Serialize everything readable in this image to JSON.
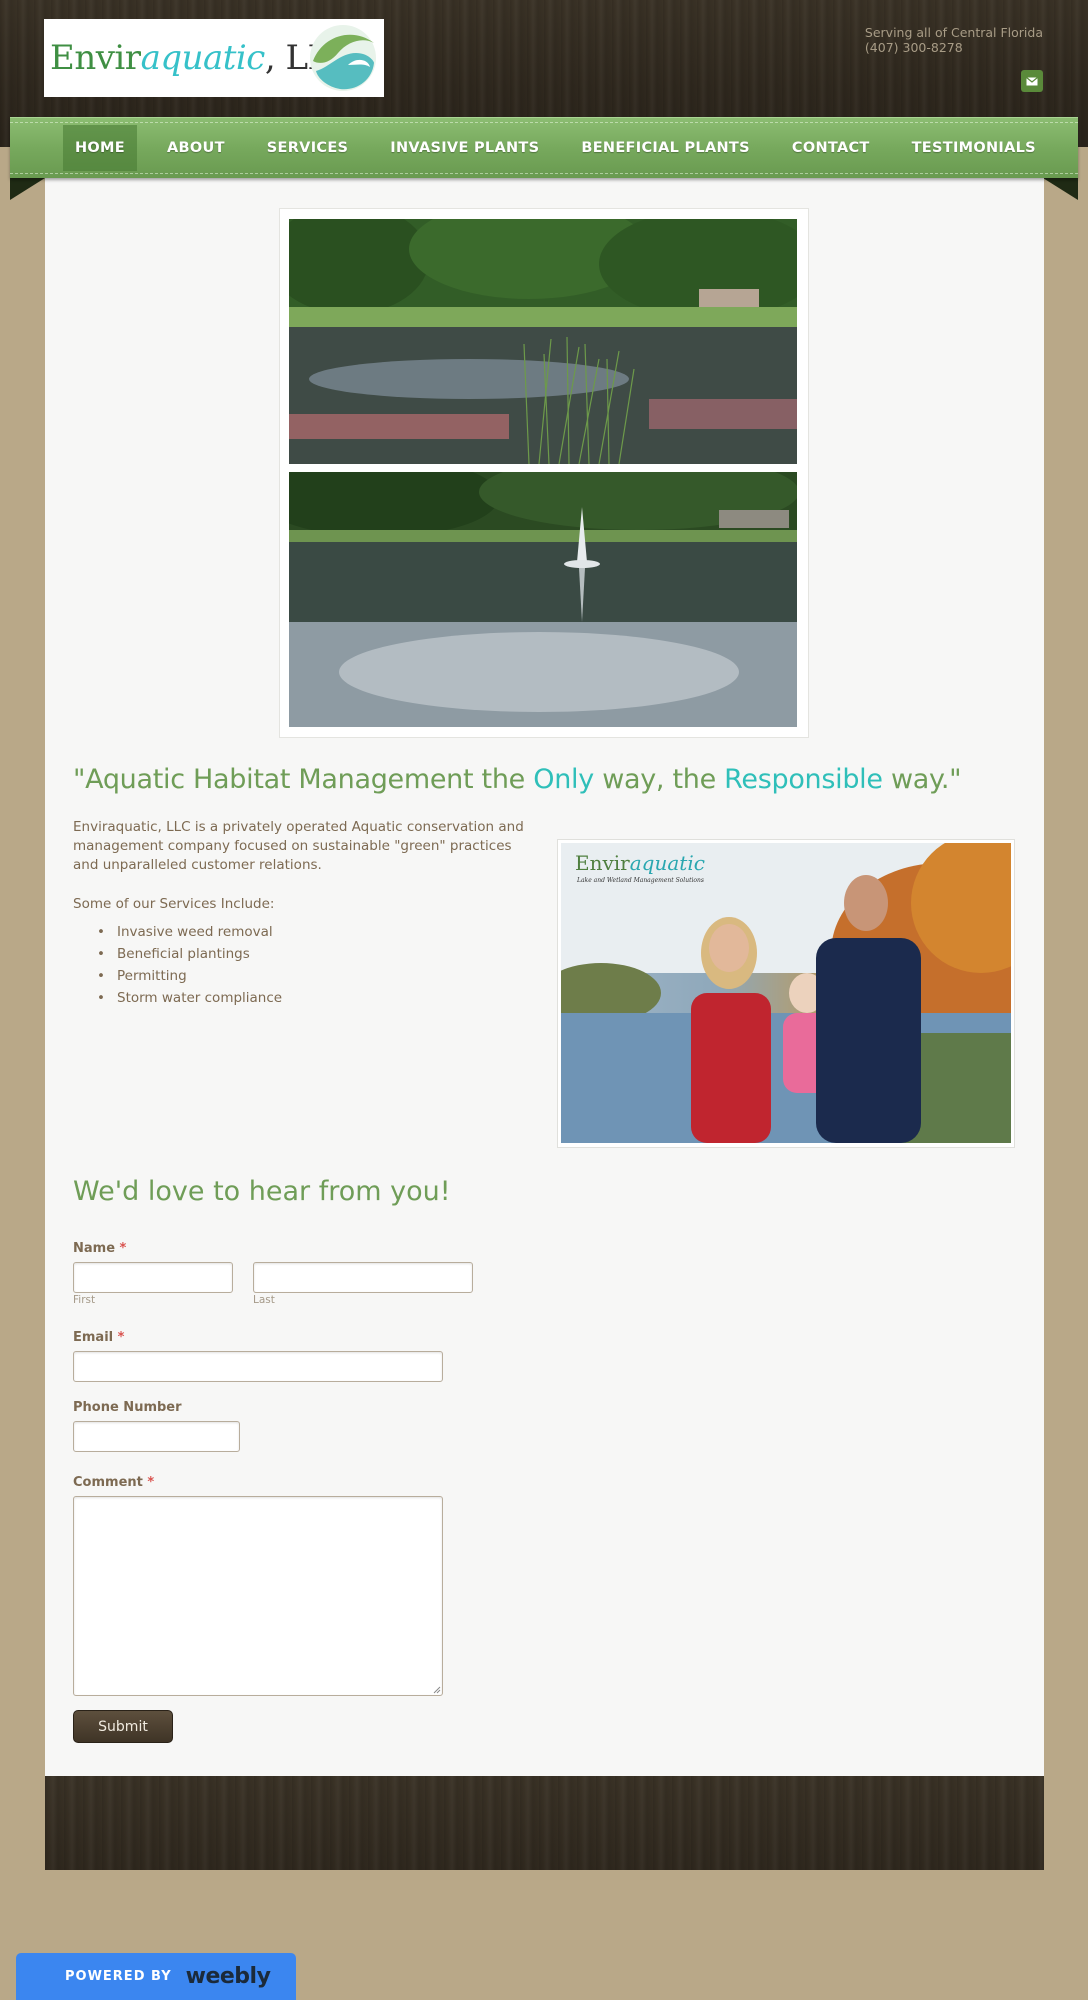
{
  "header": {
    "logo": {
      "part1": "Envir",
      "part2": "aquatic",
      "part3": ", LLC"
    },
    "tagline": "Serving all of Central Florida",
    "phone": "(407) 300-8278",
    "mail_icon": "envelope-icon"
  },
  "nav": {
    "items": [
      {
        "label": "HOME",
        "active": true
      },
      {
        "label": "ABOUT"
      },
      {
        "label": "SERVICES"
      },
      {
        "label": "INVASIVE PLANTS"
      },
      {
        "label": "BENEFICIAL PLANTS"
      },
      {
        "label": "CONTACT"
      },
      {
        "label": "TESTIMONIALS"
      }
    ]
  },
  "main": {
    "headline": {
      "a": "\"Aquatic Habitat Management the ",
      "b": "Only",
      "c": " way, the ",
      "d": "Responsible",
      "e": " way.\""
    },
    "intro": "Enviraquatic, LLC is a privately operated Aquatic conservation and management company focused on sustainable \"green\" practices and unparalleled customer relations.",
    "services_title": "Some of our Services Include:",
    "services": [
      "Invasive weed removal",
      "Beneficial plantings",
      "Permitting",
      "Storm water compliance"
    ],
    "family_photo": {
      "logo1": "Envir",
      "logo2": "aquatic",
      "tag": "Lake and Wetland Management Solutions"
    }
  },
  "form": {
    "title": "We'd love to hear from you!",
    "name_label": "Name",
    "first_label": "First",
    "last_label": "Last",
    "email_label": "Email",
    "phone_label": "Phone Number",
    "comment_label": "Comment",
    "required_mark": "*",
    "submit_label": "Submit"
  },
  "footer": {
    "powered_by": "POWERED BY",
    "brand": "weebly"
  },
  "colors": {
    "nav_green": "#77a95d",
    "accent_teal": "#2fbfb9",
    "headline_green": "#6f9d57",
    "weebly_blue": "#3b86f0"
  }
}
